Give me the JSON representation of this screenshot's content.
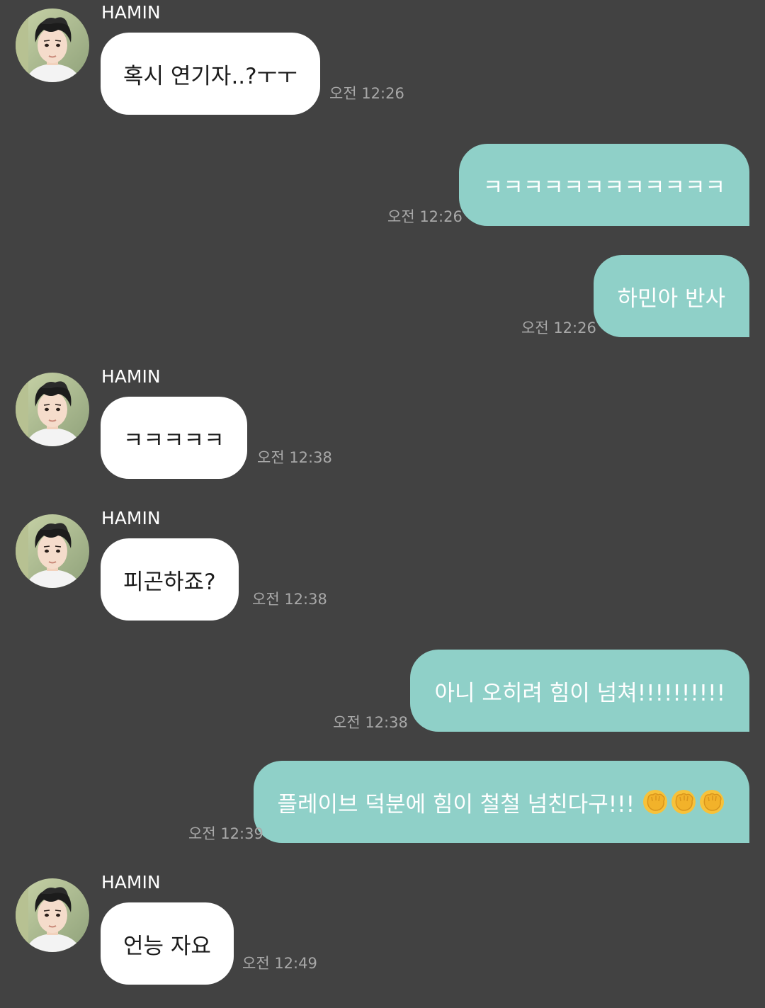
{
  "colors": {
    "background": "#424242",
    "incoming_bubble": "#ffffff",
    "outgoing_bubble": "#8fd0c8",
    "timestamp": "#a8a8a8"
  },
  "messages": [
    {
      "direction": "incoming",
      "sender": "HAMIN",
      "text": "혹시 연기자..?ㅜㅜ",
      "time": "오전 12:26"
    },
    {
      "direction": "outgoing",
      "text": "ㅋㅋㅋㅋㅋㅋㅋㅋㅋㅋㅋㅋ",
      "time": "오전 12:26"
    },
    {
      "direction": "outgoing",
      "text": "하민아 반사",
      "time": "오전 12:26"
    },
    {
      "direction": "incoming",
      "sender": "HAMIN",
      "text": "ㅋㅋㅋㅋㅋ",
      "time": "오전 12:38"
    },
    {
      "direction": "incoming",
      "sender": "HAMIN",
      "text": "피곤하죠?",
      "time": "오전 12:38"
    },
    {
      "direction": "outgoing",
      "text": "아니 오히려 힘이 넘쳐!!!!!!!!!!",
      "time": "오전 12:38"
    },
    {
      "direction": "outgoing",
      "text": "플레이브 덕분에 힘이 철철 넘친다구!!!",
      "emoji": [
        "raised-fist",
        "raised-fist",
        "raised-fist"
      ],
      "time": "오전 12:39"
    },
    {
      "direction": "incoming",
      "sender": "HAMIN",
      "text": "언능 자요",
      "time": "오전 12:49"
    }
  ]
}
